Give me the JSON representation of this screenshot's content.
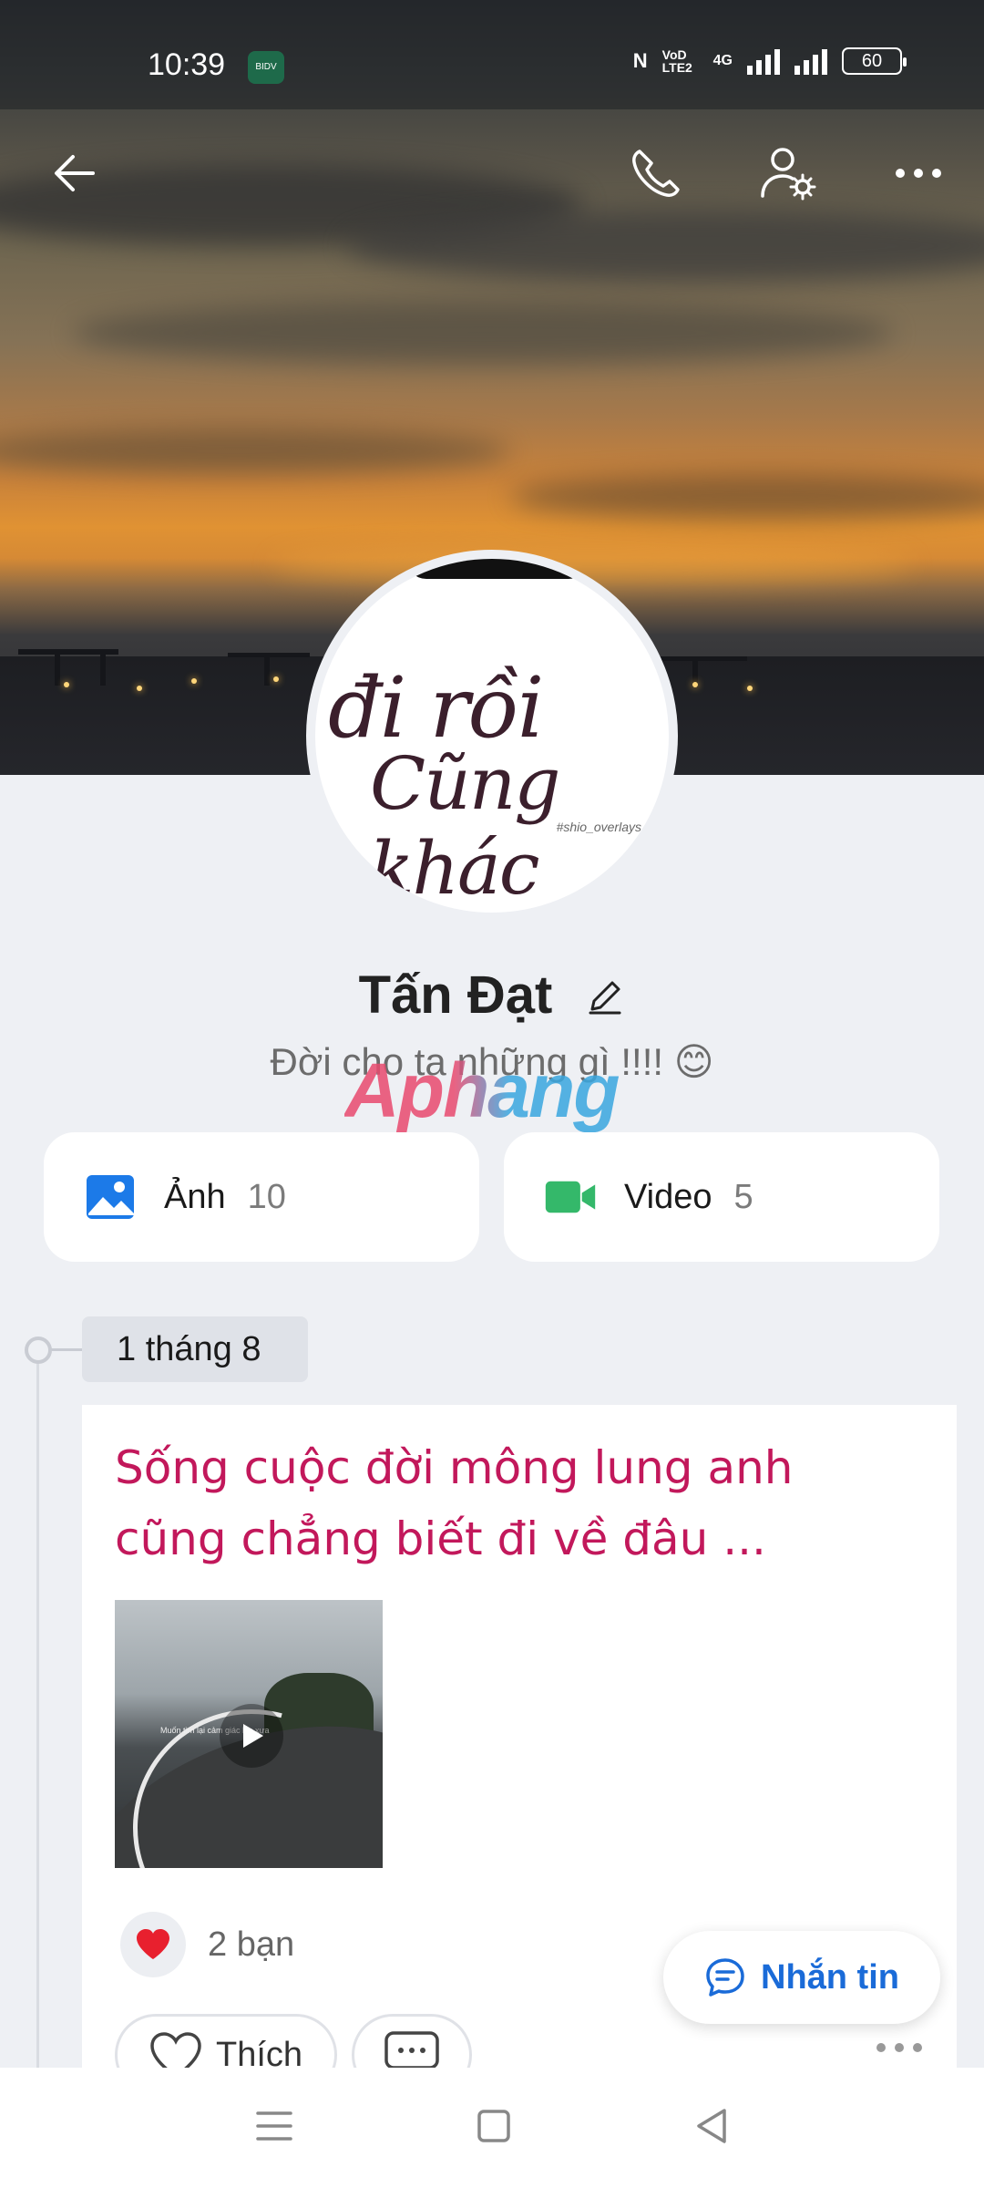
{
  "status_bar": {
    "time": "10:39",
    "app_badge": "BIDV",
    "nfc": "N",
    "volte": "VoD LTE2",
    "network": "4G",
    "battery": "60"
  },
  "header": {
    "back_icon": "arrow-left-icon",
    "call_icon": "phone-icon",
    "settings_icon": "user-settings-icon",
    "more_icon": "more-horizontal-icon"
  },
  "avatar": {
    "line1": "đi rồi",
    "line2": "Cũng khác",
    "tag": "#shio_overlays"
  },
  "profile": {
    "name": "Tấn Đạt",
    "bio": "Đời cho ta những gì !!!! 😊",
    "watermark": "Aphang"
  },
  "media": {
    "photos_label": "Ảnh",
    "photos_count": "10",
    "videos_label": "Video",
    "videos_count": "5"
  },
  "timeline": {
    "date": "1 tháng 8",
    "post_text": "Sống cuộc đời mông lung anh cũng chẳng biết đi về đâu ...",
    "thumb_caption": "Muốn tìm lại cảm giác lúc xưa",
    "reactions": "2 bạn",
    "like_label": "Thích"
  },
  "fab": {
    "message_label": "Nhắn tin"
  },
  "colors": {
    "accent": "#1a6bd8",
    "post_text": "#c2185b",
    "video_icon": "#34b86a",
    "photo_icon": "#1c7ae8"
  }
}
